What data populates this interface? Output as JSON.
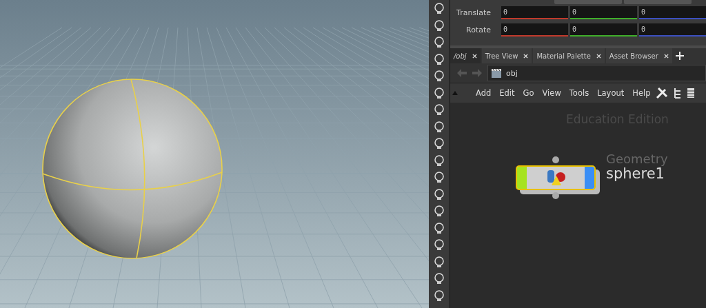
{
  "parameters": [
    {
      "label": "Translate",
      "values": [
        "0",
        "0",
        "0"
      ]
    },
    {
      "label": "Rotate",
      "values": [
        "0",
        "0",
        "0"
      ]
    }
  ],
  "tabs": [
    {
      "label": "/obj",
      "selected": true
    },
    {
      "label": "Tree View",
      "selected": false
    },
    {
      "label": "Material Palette",
      "selected": false
    },
    {
      "label": "Asset Browser",
      "selected": false
    }
  ],
  "path": "obj",
  "menu": [
    "Add",
    "Edit",
    "Go",
    "View",
    "Tools",
    "Layout",
    "Help"
  ],
  "network": {
    "edition": "Education Edition",
    "node": {
      "type": "Geometry",
      "name": "sphere1",
      "selected": true
    }
  }
}
